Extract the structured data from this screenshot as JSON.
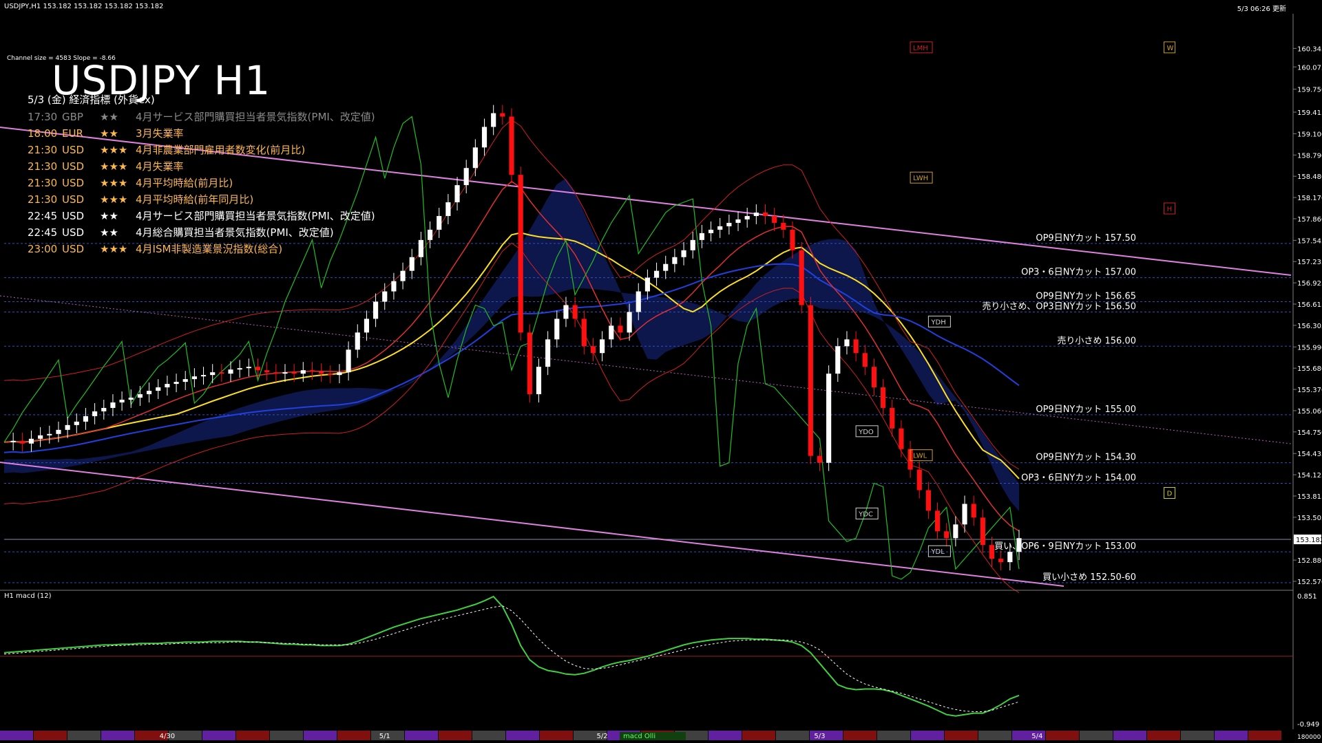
{
  "header": {
    "symbol_info": "USDJPY,H1  153.182 153.182 153.182 153.182",
    "datetime": "5/3 06:26 更新",
    "channel_info": "Channel size = 4583 Slope = -8.66",
    "chart_title": "USDJPY H1",
    "events_title": "5/3 (金) 経済指標 (外貨ex)"
  },
  "events": [
    {
      "time": "17:30",
      "currency": "GBP",
      "stars": "★★",
      "name": "4月サービス部門購買担当者景気指数(PMI、改定値)",
      "color": "#8a8a8a"
    },
    {
      "time": "18:00",
      "currency": "EUR",
      "stars": "★★",
      "name": "3月失業率",
      "color": "#ffb84a"
    },
    {
      "time": "21:30",
      "currency": "USD",
      "stars": "★★★",
      "name": "4月非農業部門雇用者数変化(前月比)",
      "color": "#ffb84a"
    },
    {
      "time": "21:30",
      "currency": "USD",
      "stars": "★★★",
      "name": "4月失業率",
      "color": "#ffb84a"
    },
    {
      "time": "21:30",
      "currency": "USD",
      "stars": "★★★",
      "name": "4月平均時給(前月比)",
      "color": "#ffb84a"
    },
    {
      "time": "21:30",
      "currency": "USD",
      "stars": "★★★",
      "name": "4月平均時給(前年同月比)",
      "color": "#ffb84a"
    },
    {
      "time": "22:45",
      "currency": "USD",
      "stars": "★★",
      "name": "4月サービス部門購買担当者景気指数(PMI、改定値)",
      "color": "#ffffff"
    },
    {
      "time": "22:45",
      "currency": "USD",
      "stars": "★★",
      "name": "4月総合購買担当者景気指数(PMI、改定値)",
      "color": "#ffffff"
    },
    {
      "time": "23:00",
      "currency": "USD",
      "stars": "★★★",
      "name": "4月ISM非製造業景況指数(総合)",
      "color": "#ffb84a"
    }
  ],
  "chart_data": {
    "type": "line",
    "y_axis_ticks": [
      160.345,
      160.075,
      159.75,
      159.415,
      159.1,
      158.79,
      158.48,
      158.17,
      157.86,
      157.545,
      157.235,
      156.925,
      156.615,
      156.305,
      155.99,
      155.68,
      155.37,
      155.06,
      154.75,
      154.435,
      154.125,
      153.815,
      153.505,
      152.88,
      152.57
    ],
    "ylim": [
      152.5,
      160.75
    ],
    "current_price": "153.182",
    "x_labels": [
      {
        "label": "4/30",
        "i": 18
      },
      {
        "label": "5/1",
        "i": 42
      },
      {
        "label": "5/2",
        "i": 66
      },
      {
        "label": "5/3",
        "i": 90
      },
      {
        "label": "5/4",
        "i": 114
      }
    ],
    "price_series": [
      154.6,
      154.62,
      154.58,
      154.65,
      154.7,
      154.72,
      154.78,
      154.85,
      154.9,
      154.98,
      155.05,
      155.1,
      155.18,
      155.22,
      155.25,
      155.3,
      155.35,
      155.4,
      155.45,
      155.48,
      155.52,
      155.56,
      155.58,
      155.62,
      155.6,
      155.66,
      155.68,
      155.7,
      155.65,
      155.62,
      155.6,
      155.62,
      155.6,
      155.65,
      155.63,
      155.6,
      155.58,
      155.62,
      155.95,
      156.2,
      156.4,
      156.65,
      156.8,
      156.95,
      157.1,
      157.3,
      157.55,
      157.7,
      157.9,
      158.1,
      158.35,
      158.6,
      158.9,
      159.2,
      159.4,
      159.35,
      158.5,
      156.2,
      155.3,
      155.7,
      156.1,
      156.4,
      156.6,
      156.4,
      156.0,
      155.9,
      156.1,
      156.3,
      156.2,
      156.5,
      156.8,
      157.0,
      157.1,
      157.2,
      157.3,
      157.4,
      157.55,
      157.65,
      157.7,
      157.75,
      157.8,
      157.85,
      157.9,
      157.95,
      157.9,
      157.8,
      157.7,
      157.4,
      156.6,
      154.4,
      154.3,
      155.6,
      156.0,
      156.1,
      155.9,
      155.7,
      155.4,
      155.1,
      154.8,
      154.5,
      154.2,
      153.9,
      153.6,
      153.3,
      153.2,
      153.4,
      153.7,
      153.5,
      153.1,
      152.9,
      152.85,
      153.0,
      153.2
    ],
    "horizontal_levels": [
      {
        "label": "OP9日NYカット 157.50",
        "value": 157.5
      },
      {
        "label": "OP3・6日NYカット 157.00",
        "value": 157.0
      },
      {
        "label": "OP9日NYカット 156.65",
        "value": 156.65
      },
      {
        "label": "売り小さめ、OP3日NYカット 156.50",
        "value": 156.5
      },
      {
        "label": "売り小さめ 156.00",
        "value": 156.0
      },
      {
        "label": "OP9日NYカット 155.00",
        "value": 155.0
      },
      {
        "label": "OP9日NYカット 154.30",
        "value": 154.3
      },
      {
        "label": "OP3・6日NYカット 154.00",
        "value": 154.0
      },
      {
        "label": "買い、OP6・9日NYカット 153.00",
        "value": 153.0
      },
      {
        "label": "買い小さめ 152.50-60",
        "value": 152.55
      }
    ],
    "markers": [
      {
        "label": "LMH",
        "value": 160.35,
        "i": 100,
        "color": "#d02020"
      },
      {
        "label": "W",
        "value": 160.35,
        "i": 128,
        "color": "#d0a020"
      },
      {
        "label": "LWH",
        "value": 158.45,
        "i": 100,
        "color": "#d0a020"
      },
      {
        "label": "H",
        "value": 158.0,
        "i": 128,
        "color": "#d02020"
      },
      {
        "label": "YDH",
        "value": 156.35,
        "i": 102,
        "color": "#d0d0d0"
      },
      {
        "label": "YDO",
        "value": 154.75,
        "i": 94,
        "color": "#d0d0d0"
      },
      {
        "label": "LWL",
        "value": 154.4,
        "i": 100,
        "color": "#d0a020"
      },
      {
        "label": "D",
        "value": 153.85,
        "i": 128,
        "color": "#d0d020"
      },
      {
        "label": "YDC",
        "value": 153.55,
        "i": 94,
        "color": "#d0d0d0"
      },
      {
        "label": "YDL",
        "value": 153.0,
        "i": 102,
        "color": "#d0d0d0"
      }
    ],
    "macd": {
      "label": "H1  macd (12)",
      "ticks": [
        "0.851",
        "-0.949"
      ],
      "ylim": [
        -0.949,
        0.851
      ],
      "zero_line": 0,
      "bottom_value": "180000",
      "badge": "macd Olli",
      "main": [
        0.05,
        0.06,
        0.07,
        0.08,
        0.09,
        0.1,
        0.11,
        0.12,
        0.13,
        0.14,
        0.15,
        0.16,
        0.16,
        0.17,
        0.17,
        0.18,
        0.18,
        0.18,
        0.19,
        0.19,
        0.2,
        0.2,
        0.2,
        0.21,
        0.21,
        0.21,
        0.21,
        0.2,
        0.2,
        0.19,
        0.18,
        0.17,
        0.17,
        0.16,
        0.16,
        0.15,
        0.15,
        0.15,
        0.17,
        0.21,
        0.26,
        0.31,
        0.36,
        0.41,
        0.45,
        0.49,
        0.53,
        0.56,
        0.59,
        0.62,
        0.65,
        0.69,
        0.73,
        0.78,
        0.84,
        0.7,
        0.45,
        0.15,
        -0.05,
        -0.15,
        -0.2,
        -0.22,
        -0.25,
        -0.26,
        -0.24,
        -0.2,
        -0.15,
        -0.11,
        -0.08,
        -0.06,
        -0.03,
        0.0,
        0.04,
        0.08,
        0.12,
        0.16,
        0.19,
        0.21,
        0.23,
        0.24,
        0.25,
        0.25,
        0.25,
        0.24,
        0.24,
        0.23,
        0.22,
        0.2,
        0.15,
        0.05,
        -0.1,
        -0.25,
        -0.4,
        -0.45,
        -0.47,
        -0.46,
        -0.46,
        -0.47,
        -0.5,
        -0.55,
        -0.6,
        -0.65,
        -0.7,
        -0.76,
        -0.82,
        -0.84,
        -0.82,
        -0.8,
        -0.8,
        -0.75,
        -0.68,
        -0.6,
        -0.55
      ],
      "signal": [
        0.03,
        0.04,
        0.05,
        0.06,
        0.07,
        0.08,
        0.09,
        0.1,
        0.11,
        0.12,
        0.13,
        0.14,
        0.15,
        0.15,
        0.16,
        0.16,
        0.17,
        0.17,
        0.17,
        0.18,
        0.18,
        0.18,
        0.19,
        0.19,
        0.19,
        0.2,
        0.2,
        0.2,
        0.2,
        0.19,
        0.19,
        0.18,
        0.18,
        0.17,
        0.17,
        0.16,
        0.16,
        0.16,
        0.16,
        0.18,
        0.21,
        0.24,
        0.28,
        0.32,
        0.36,
        0.4,
        0.44,
        0.48,
        0.51,
        0.54,
        0.57,
        0.6,
        0.63,
        0.66,
        0.69,
        0.71,
        0.64,
        0.52,
        0.38,
        0.24,
        0.12,
        0.02,
        -0.07,
        -0.13,
        -0.17,
        -0.18,
        -0.17,
        -0.15,
        -0.12,
        -0.09,
        -0.06,
        -0.03,
        0.0,
        0.03,
        0.06,
        0.09,
        0.12,
        0.15,
        0.17,
        0.19,
        0.21,
        0.22,
        0.23,
        0.23,
        0.23,
        0.23,
        0.23,
        0.22,
        0.2,
        0.16,
        0.09,
        -0.02,
        -0.14,
        -0.25,
        -0.33,
        -0.39,
        -0.43,
        -0.46,
        -0.49,
        -0.52,
        -0.56,
        -0.6,
        -0.64,
        -0.68,
        -0.72,
        -0.75,
        -0.77,
        -0.78,
        -0.78,
        -0.76,
        -0.72,
        -0.68,
        -0.64
      ]
    }
  }
}
